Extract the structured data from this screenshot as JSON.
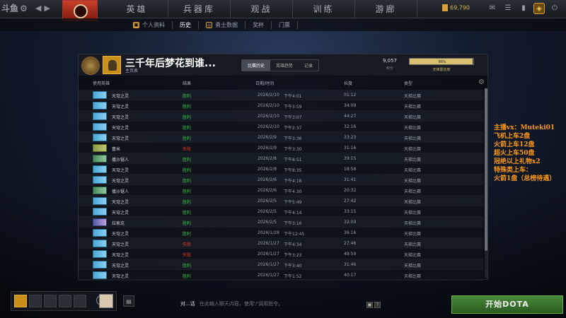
{
  "topbar": {
    "logo": "斗鱼",
    "nav": [
      "英雄",
      "兵器库",
      "观战",
      "训练",
      "游廊"
    ],
    "gold": "69,790"
  },
  "subnav": {
    "items": [
      {
        "label": "个人资料",
        "active": false
      },
      {
        "label": "历史",
        "active": true
      },
      {
        "label": "勇士数据",
        "active": false
      },
      {
        "label": "奖杯",
        "active": false
      },
      {
        "label": "门票",
        "active": false
      }
    ]
  },
  "profile": {
    "name": "三千年后梦花到谁...",
    "sub": "主页表",
    "tabs": [
      "比赛历史",
      "英雄趋势",
      "记录"
    ],
    "score_value": "9,057",
    "score_label": "积分",
    "bar_text": "99%",
    "bar_label": "天梯置信度",
    "bar_fraction": 0.99
  },
  "table": {
    "headers": {
      "hero": "使用英雄",
      "result": "结果",
      "date": "日期/时间",
      "duration": "长度",
      "type": "类型"
    },
    "rows": [
      {
        "hero": "天穹之灵",
        "icon": "blue",
        "result": "胜利",
        "win": true,
        "date": "2026/2/10",
        "time": "下午4:01",
        "duration": "01:12",
        "type": "天梯比赛"
      },
      {
        "hero": "天穹之灵",
        "icon": "blue",
        "result": "胜利",
        "win": true,
        "date": "2026/2/10",
        "time": "下午3:59",
        "duration": "34:09",
        "type": "天梯比赛"
      },
      {
        "hero": "天穹之灵",
        "icon": "blue",
        "result": "胜利",
        "win": true,
        "date": "2026/2/10",
        "time": "下午3:07",
        "duration": "44:27",
        "type": "天梯比赛"
      },
      {
        "hero": "天穹之灵",
        "icon": "blue",
        "result": "胜利",
        "win": true,
        "date": "2026/2/10",
        "time": "下午2:37",
        "duration": "32:16",
        "type": "天梯比赛"
      },
      {
        "hero": "天穹之灵",
        "icon": "blue",
        "result": "胜利",
        "win": true,
        "date": "2026/2/9",
        "time": "下午3:36",
        "duration": "33:23",
        "type": "天梯比赛"
      },
      {
        "hero": "蕾米",
        "icon": "olive",
        "result": "失败",
        "win": false,
        "date": "2026/2/9",
        "time": "下午3:30",
        "duration": "31:16",
        "type": "天梯比赛"
      },
      {
        "hero": "播沙锯人",
        "icon": "green",
        "result": "胜利",
        "win": true,
        "date": "2026/2/8",
        "time": "下午8:51",
        "duration": "39:15",
        "type": "天梯比赛"
      },
      {
        "hero": "天穹之灵",
        "icon": "blue",
        "result": "胜利",
        "win": true,
        "date": "2026/2/8",
        "time": "下午8:35",
        "duration": "18:58",
        "type": "天梯比赛"
      },
      {
        "hero": "天穹之灵",
        "icon": "blue",
        "result": "胜利",
        "win": true,
        "date": "2026/2/6",
        "time": "下午4:18",
        "duration": "31:41",
        "type": "天梯比赛"
      },
      {
        "hero": "播沙锯人",
        "icon": "green",
        "result": "胜利",
        "win": true,
        "date": "2026/2/6",
        "time": "下午4:30",
        "duration": "20:32",
        "type": "天梯比赛"
      },
      {
        "hero": "天穹之灵",
        "icon": "blue",
        "result": "胜利",
        "win": true,
        "date": "2026/2/5",
        "time": "下午5:49",
        "duration": "27:42",
        "type": "天梯比赛"
      },
      {
        "hero": "天穹之灵",
        "icon": "blue",
        "result": "胜利",
        "win": true,
        "date": "2026/2/5",
        "time": "下午4:14",
        "duration": "33:15",
        "type": "天梯比赛"
      },
      {
        "hero": "拉索克",
        "icon": "purple",
        "result": "胜利",
        "win": true,
        "date": "2026/2/5",
        "time": "下午3:16",
        "duration": "32:09",
        "type": "天梯比赛"
      },
      {
        "hero": "天穹之灵",
        "icon": "blue",
        "result": "胜利",
        "win": true,
        "date": "2026/1/28",
        "time": "下午12:45",
        "duration": "36:16",
        "type": "天梯比赛"
      },
      {
        "hero": "天穹之灵",
        "icon": "blue",
        "result": "失败",
        "win": false,
        "date": "2026/1/27",
        "time": "下午4:34",
        "duration": "27:46",
        "type": "天梯比赛"
      },
      {
        "hero": "天穹之灵",
        "icon": "blue",
        "result": "失败",
        "win": false,
        "date": "2026/1/27",
        "time": "下午3:23",
        "duration": "49:59",
        "type": "天梯比赛"
      },
      {
        "hero": "天穹之灵",
        "icon": "blue",
        "result": "胜利",
        "win": true,
        "date": "2026/1/27",
        "time": "下午3:40",
        "duration": "31:46",
        "type": "天梯比赛"
      },
      {
        "hero": "天穹之灵",
        "icon": "blue",
        "result": "胜利",
        "win": true,
        "date": "2026/1/27",
        "time": "下午1:52",
        "duration": "40:17",
        "type": "天梯比赛"
      }
    ]
  },
  "overlay": [
    "主播vx：Muteki01",
    "飞机上车2盘",
    "火箭上车12盘",
    "超火上车50盘",
    "冠绝以上礼物x2",
    "特殊类上车：",
    "火箭1盘（总榜待遇）"
  ],
  "bottom": {
    "chat_label": "对...话",
    "chat_placeholder": "在此输入聊天内容，使用'/'调用指令。",
    "play_label": "开始DOTA"
  }
}
